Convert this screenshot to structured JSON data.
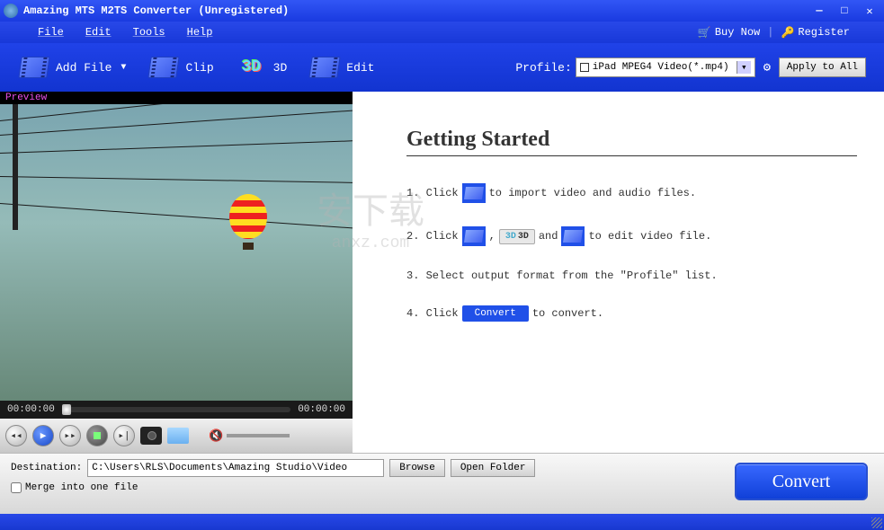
{
  "window": {
    "title": "Amazing MTS M2TS Converter (Unregistered)"
  },
  "menu": {
    "file": "File",
    "edit": "Edit",
    "tools": "Tools",
    "help": "Help",
    "buy_now": "Buy Now",
    "register": "Register"
  },
  "toolbar": {
    "add_file": "Add File",
    "clip": "Clip",
    "three_d": "3D",
    "edit": "Edit",
    "profile_label": "Profile:",
    "profile_value": "iPad MPEG4 Video(*.mp4)",
    "apply_all": "Apply to All"
  },
  "preview": {
    "label": "Preview",
    "time_start": "00:00:00",
    "time_end": "00:00:00"
  },
  "guide": {
    "heading": "Getting Started",
    "step1_a": "1. Click",
    "step1_b": "to import video and audio files.",
    "step2_a": "2. Click",
    "step2_comma": ",",
    "step2_3d": "3D",
    "step2_and": "and",
    "step2_b": "to edit video file.",
    "step3": "3. Select output format from the \"Profile\" list.",
    "step4_a": "4. Click",
    "step4_convert": "Convert",
    "step4_b": "to convert."
  },
  "bottom": {
    "dest_label": "Destination:",
    "dest_path": "C:\\Users\\RLS\\Documents\\Amazing Studio\\Video",
    "browse": "Browse",
    "open_folder": "Open Folder",
    "merge": "Merge into one file",
    "convert": "Convert"
  },
  "watermark": {
    "logo": "安下载",
    "sub": "anxz.com"
  }
}
